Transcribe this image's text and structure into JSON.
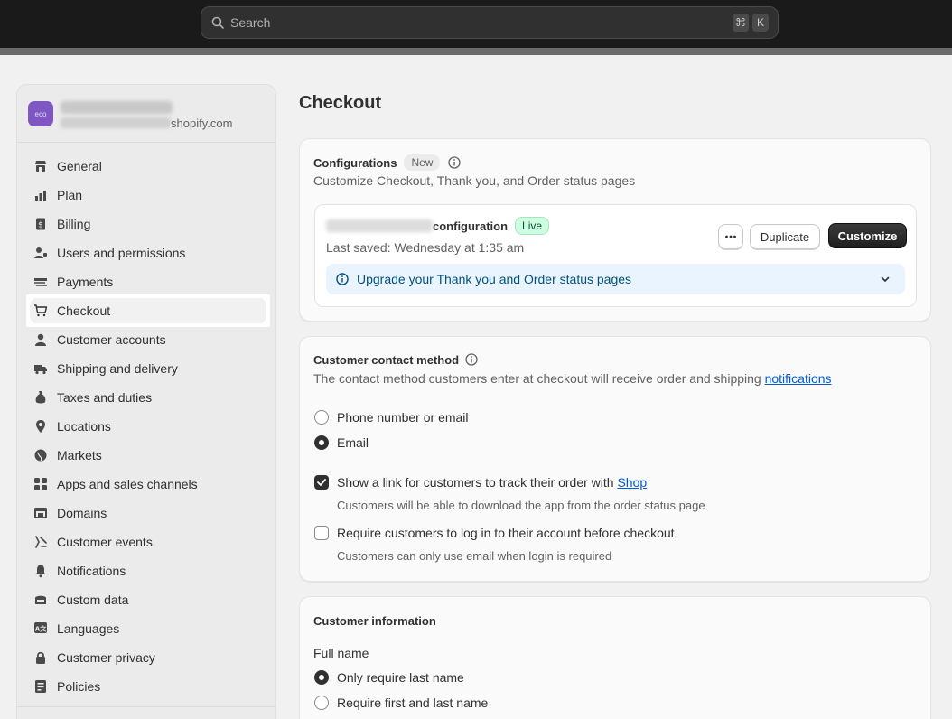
{
  "search": {
    "placeholder": "Search",
    "kbd_1": "⌘",
    "kbd_2": "K"
  },
  "store": {
    "avatar": "eco",
    "url_suffix": "shopify.com"
  },
  "sidebar": {
    "items": [
      {
        "label": "General",
        "icon": "store-icon"
      },
      {
        "label": "Plan",
        "icon": "plan-icon"
      },
      {
        "label": "Billing",
        "icon": "billing-icon"
      },
      {
        "label": "Users and permissions",
        "icon": "users-icon"
      },
      {
        "label": "Payments",
        "icon": "payments-icon"
      },
      {
        "label": "Checkout",
        "icon": "cart-icon",
        "active": true
      },
      {
        "label": "Customer accounts",
        "icon": "person-icon"
      },
      {
        "label": "Shipping and delivery",
        "icon": "truck-icon"
      },
      {
        "label": "Taxes and duties",
        "icon": "taxes-icon"
      },
      {
        "label": "Locations",
        "icon": "location-pin-icon"
      },
      {
        "label": "Markets",
        "icon": "globe-icon"
      },
      {
        "label": "Apps and sales channels",
        "icon": "apps-icon"
      },
      {
        "label": "Domains",
        "icon": "domains-icon"
      },
      {
        "label": "Customer events",
        "icon": "sparkle-icon"
      },
      {
        "label": "Notifications",
        "icon": "bell-icon"
      },
      {
        "label": "Custom data",
        "icon": "database-icon"
      },
      {
        "label": "Languages",
        "icon": "language-icon"
      },
      {
        "label": "Customer privacy",
        "icon": "lock-icon"
      },
      {
        "label": "Policies",
        "icon": "policies-icon"
      }
    ]
  },
  "main": {
    "title": "Checkout",
    "configurations": {
      "title": "Configurations",
      "badge": "New",
      "subtitle": "Customize Checkout, Thank you, and Order status pages",
      "config_name_suffix": "configuration",
      "live_badge": "Live",
      "last_saved": "Last saved: Wednesday at 1:35 am",
      "duplicate_label": "Duplicate",
      "customize_label": "Customize",
      "upgrade_text": "Upgrade your Thank you and Order status pages"
    },
    "contact": {
      "title": "Customer contact method",
      "desc_prefix": "The contact method customers enter at checkout will receive order and shipping ",
      "desc_link": "notifications",
      "option_phone": "Phone number or email",
      "option_email": "Email",
      "selected": "Email",
      "shop_link_prefix": "Show a link for customers to track their order with ",
      "shop_link": "Shop",
      "shop_link_checked": true,
      "shop_help": "Customers will be able to download the app from the order status page",
      "login_label": "Require customers to log in to their account before checkout",
      "login_checked": false,
      "login_help": "Customers can only use email when login is required"
    },
    "info": {
      "title": "Customer information",
      "full_name_label": "Full name",
      "option_last": "Only require last name",
      "option_first_last": "Require first and last name",
      "selected": "Only require last name"
    }
  },
  "colors": {
    "accent": "#303030",
    "link": "#005bd3",
    "live": "#cdfee1",
    "info": "#eaf4ff"
  }
}
